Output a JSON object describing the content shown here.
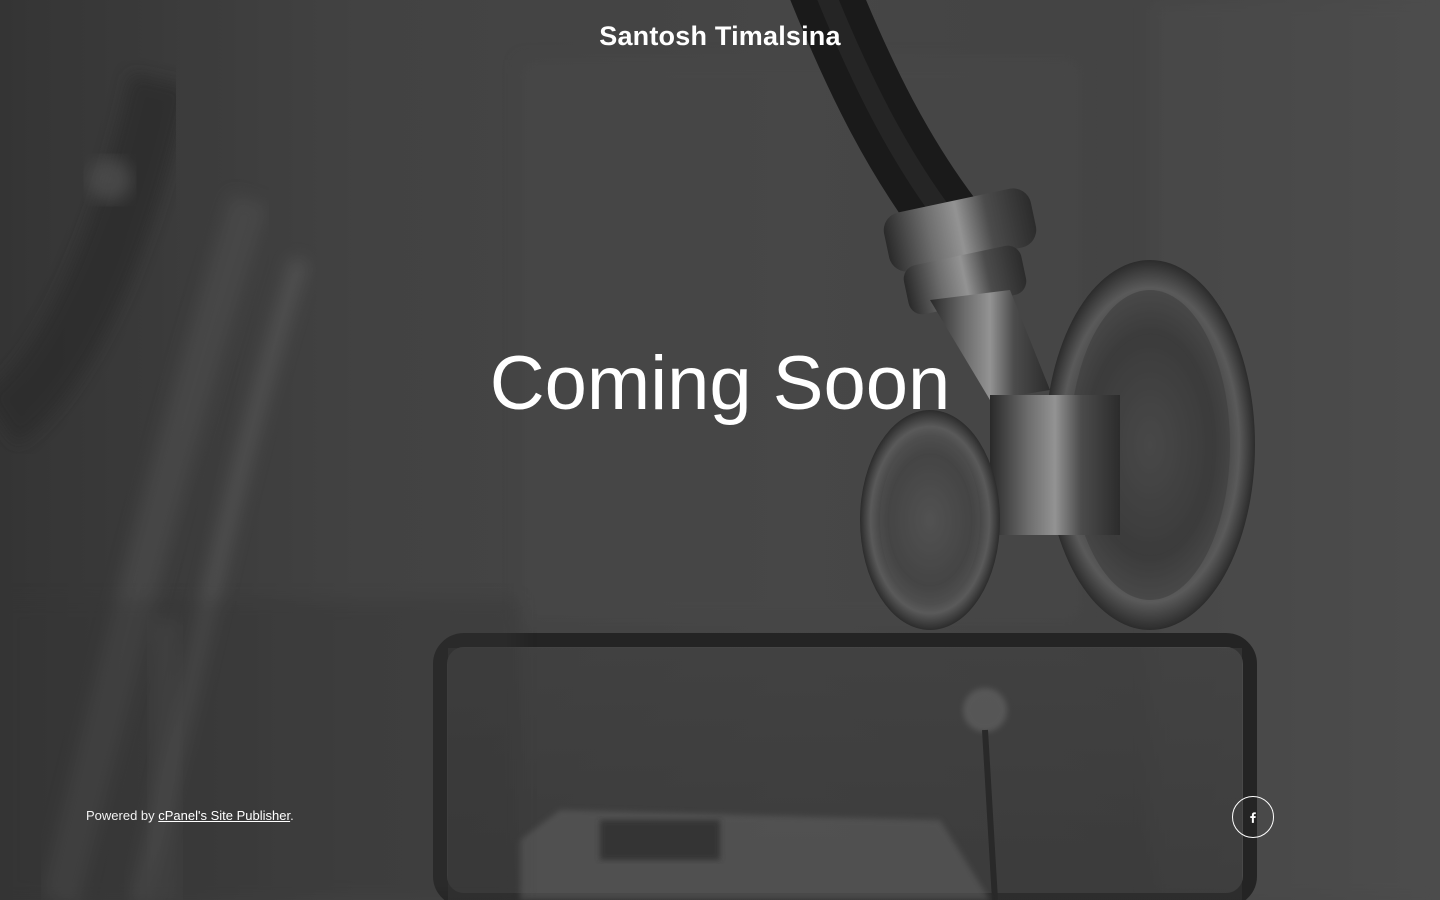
{
  "header": {
    "site_title": "Santosh Timalsina"
  },
  "main": {
    "headline": "Coming Soon"
  },
  "footer": {
    "powered_prefix": "Powered by ",
    "powered_link": "cPanel's Site Publisher",
    "powered_suffix": "."
  },
  "social": {
    "facebook_icon": "facebook-icon"
  },
  "colors": {
    "text": "#ffffff",
    "overlay": "#4a4a4a"
  }
}
